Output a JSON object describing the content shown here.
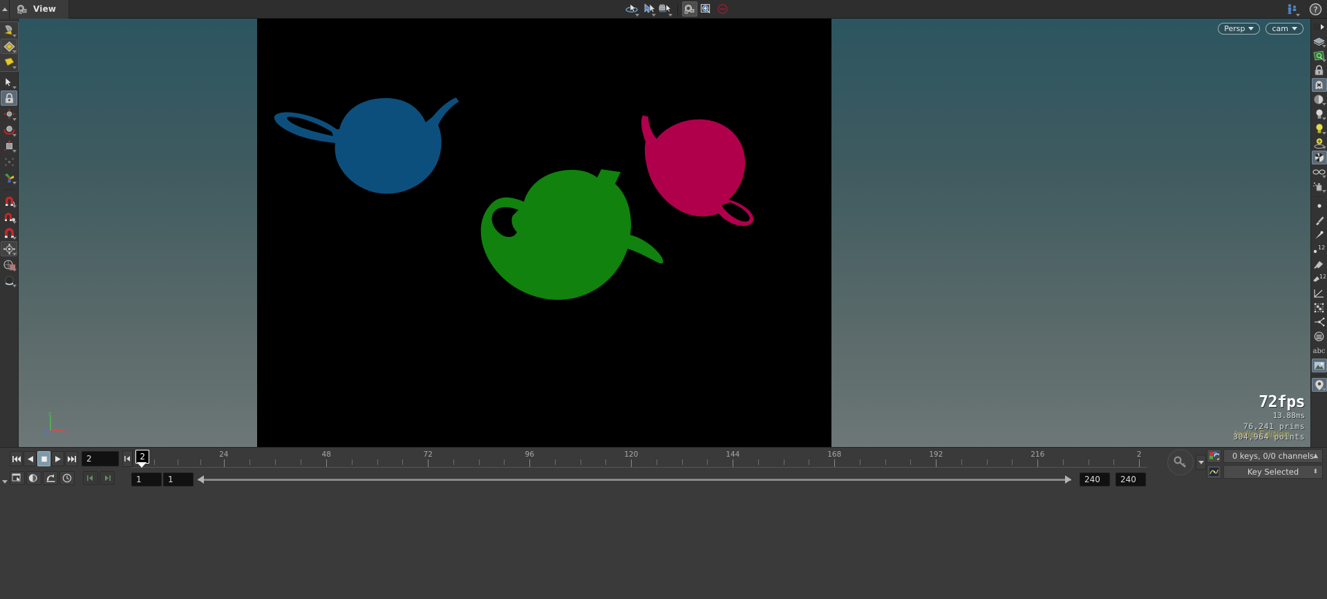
{
  "window": {
    "tab_label": "View",
    "tab_icon": "camera-icon",
    "pin_icon": "pin-triangle-icon"
  },
  "view_toolbar": {
    "tools": [
      {
        "name": "orbit-tool",
        "icon": "orbit-cursor-icon",
        "active": false,
        "has_menu": true
      },
      {
        "name": "select-tool",
        "icon": "arrow-cursor-icon",
        "active": false,
        "has_menu": true
      },
      {
        "name": "camera-cursor-tool",
        "icon": "camera-cursor-icon",
        "active": false,
        "has_menu": true
      },
      {
        "name": "camera-view-tool",
        "icon": "camera-icon",
        "active": true,
        "has_menu": false
      },
      {
        "name": "zoom-region-tool",
        "icon": "magnifier-box-icon",
        "active": false,
        "has_menu": false
      },
      {
        "name": "disable-tool",
        "icon": "circle-minus-icon",
        "active": false,
        "has_menu": false
      }
    ],
    "right_icons": [
      {
        "name": "network-users-icon",
        "icon": "two-people-icon",
        "has_menu": true
      },
      {
        "name": "help-icon",
        "icon": "question-mark-circle-icon"
      }
    ]
  },
  "left_toolbar": {
    "items": [
      {
        "name": "handle-tool",
        "icon": "grey-yellow-shape-icon",
        "state": "framed",
        "has_menu": true
      },
      {
        "name": "diamond-tool",
        "icon": "diamond-icon",
        "state": "framed",
        "has_menu": true
      },
      {
        "name": "square-tool",
        "icon": "yellow-square-icon",
        "state": "framed",
        "has_menu": true
      },
      {
        "name": "select-arrow-tool",
        "icon": "arrow-cursor-icon",
        "state": "normal",
        "has_menu": true
      },
      {
        "name": "lock-handles-tool",
        "icon": "lock-icon",
        "state": "selected",
        "has_menu": false
      },
      {
        "name": "move-tool",
        "icon": "move-handles-icon",
        "state": "normal",
        "has_menu": true
      },
      {
        "name": "rotate-tool",
        "icon": "rotate-handles-icon",
        "state": "normal",
        "has_menu": true
      },
      {
        "name": "scale-tool",
        "icon": "scale-handles-icon",
        "state": "normal",
        "has_menu": true
      },
      {
        "name": "pivot-tool",
        "icon": "pivot-icon",
        "state": "normal",
        "has_menu": false
      },
      {
        "name": "axis-gizmo-tool",
        "icon": "rgb-axis-icon",
        "state": "normal",
        "has_menu": true
      },
      {
        "name": "snap-magnet-tool",
        "icon": "magnet-icon",
        "state": "normal",
        "has_menu": true
      },
      {
        "name": "snap-point-tool",
        "icon": "magnet-point-icon",
        "state": "normal",
        "has_menu": true
      },
      {
        "name": "snap-grid-tool",
        "icon": "magnet-grid-icon",
        "state": "normal",
        "has_menu": true
      },
      {
        "name": "object-mode-tool",
        "icon": "gear-object-icon",
        "state": "framed",
        "has_menu": true
      },
      {
        "name": "construction-plane-tool",
        "icon": "circle-square-icon",
        "state": "normal",
        "has_menu": true
      },
      {
        "name": "material-ball-tool",
        "icon": "dark-ball-icon",
        "state": "normal",
        "has_menu": true
      }
    ]
  },
  "right_toolbar": {
    "items": [
      {
        "name": "expand-panel",
        "icon": "right-arrow-icon"
      },
      {
        "name": "display-layers",
        "icon": "layers-icon",
        "has_menu": true
      },
      {
        "name": "display-options",
        "icon": "green-display-icon",
        "has_menu": true
      },
      {
        "name": "lock-view",
        "icon": "padlock-icon"
      },
      {
        "name": "ghost-display",
        "icon": "ghost-x-icon",
        "state": "framed"
      },
      {
        "name": "shaded-sphere",
        "icon": "sphere-shaded-icon",
        "has_menu": true
      },
      {
        "name": "headlight",
        "icon": "bulb-icon",
        "has_menu": true
      },
      {
        "name": "scene-light",
        "icon": "yellow-bulb-icon",
        "has_menu": true
      },
      {
        "name": "light-handle",
        "icon": "light-stand-icon",
        "has_menu": true
      },
      {
        "name": "material-preview",
        "icon": "checker-ball-icon",
        "state": "framed"
      },
      {
        "name": "xray-glasses",
        "icon": "glasses-icon",
        "has_menu": true
      },
      {
        "name": "paint-spray",
        "icon": "spray-icon",
        "has_menu": true
      },
      {
        "name": "point-display",
        "icon": "dot-icon"
      },
      {
        "name": "brush-tool",
        "icon": "brush-icon"
      },
      {
        "name": "pin-marker",
        "icon": "pin-icon"
      },
      {
        "name": "point-numbers",
        "icon": "point-number-12-icon"
      },
      {
        "name": "select-hand",
        "icon": "hand-icon"
      },
      {
        "name": "prim-numbers",
        "icon": "prim-number-12-icon"
      },
      {
        "name": "measure-angle",
        "icon": "angle-measure-icon"
      },
      {
        "name": "bounding-box",
        "icon": "bbox-checker-icon"
      },
      {
        "name": "connectivity",
        "icon": "connector-icon"
      },
      {
        "name": "stack-circle",
        "icon": "circle-stack-icon"
      },
      {
        "name": "text-display",
        "icon": "abc-text-icon",
        "label": "abc"
      },
      {
        "name": "background-image",
        "icon": "image-icon",
        "state": "framed"
      },
      {
        "name": "location-pin",
        "icon": "map-pin-icon",
        "state": "framed",
        "has_menu": true
      }
    ]
  },
  "viewport": {
    "view_mode": {
      "label": "Persp",
      "icon": "chevron-down-icon"
    },
    "camera": {
      "label": "cam",
      "icon": "chevron-down-icon"
    },
    "axis_gizmo": {
      "labels": [
        "y",
        "z",
        "x"
      ],
      "colors": [
        "#44cc44",
        "#4477ee",
        "#ee4444"
      ]
    },
    "background_gradient": [
      "#2c5560",
      "#3f5b60",
      "#5c6b6b",
      "#6d7777"
    ],
    "render_region_color": "#000000",
    "stats": {
      "fps": "72fps",
      "frame_time": "13.88ms",
      "prims": "76,241  prims",
      "points": "304,964 points",
      "watermark": "Indie Edition"
    },
    "objects": [
      {
        "name": "teapot-blue",
        "color": "#0d4f7c"
      },
      {
        "name": "teapot-green",
        "color": "#10820d"
      },
      {
        "name": "teapot-crimson",
        "color": "#b0004c"
      }
    ]
  },
  "playbar": {
    "transport": [
      {
        "name": "jump-to-start-button",
        "icon": "skip-back-icon",
        "active": false
      },
      {
        "name": "play-backward-button",
        "icon": "play-back-icon",
        "active": false
      },
      {
        "name": "stop-button",
        "icon": "stop-square-icon",
        "active": true
      },
      {
        "name": "play-forward-button",
        "icon": "play-icon",
        "active": false
      },
      {
        "name": "jump-to-end-button",
        "icon": "skip-forward-icon",
        "active": false
      }
    ],
    "current_frame": "2",
    "step_back_icon": "step-back-icon",
    "step_forward_icon": "step-forward-icon",
    "transport2": [
      {
        "name": "snapshot-button",
        "icon": "snapshot-window-icon"
      },
      {
        "name": "audio-button",
        "icon": "speaker-icon"
      },
      {
        "name": "realtime-button",
        "icon": "realtime-icon"
      },
      {
        "name": "time-button",
        "icon": "clock-icon"
      },
      {
        "name": "prev-key-button",
        "icon": "prev-key-icon",
        "dim": true
      },
      {
        "name": "next-key-button",
        "icon": "next-key-icon",
        "dim": true
      }
    ],
    "playhead_frame": "2",
    "timeline_ticks": [
      {
        "label": "24",
        "pos": 9.1
      },
      {
        "label": "48",
        "pos": 19.2
      },
      {
        "label": "72",
        "pos": 29.2
      },
      {
        "label": "96",
        "pos": 39.2
      },
      {
        "label": "120",
        "pos": 49.2
      },
      {
        "label": "144",
        "pos": 59.2
      },
      {
        "label": "168",
        "pos": 69.2
      },
      {
        "label": "192",
        "pos": 79.2
      },
      {
        "label": "216",
        "pos": 89.2
      },
      {
        "label": "2",
        "pos": 99.2
      }
    ],
    "range_start": "1",
    "range_start_global": "1",
    "range_end": "240",
    "range_end_global": "240",
    "key_button": {
      "name": "set-key-button",
      "icon": "key-icon",
      "has_menu": true
    },
    "channel_rows": [
      {
        "icon": "channel-color-icon",
        "label": "0 keys, 0/0 channels",
        "arrow": "▲"
      },
      {
        "icon": "curve-editor-icon",
        "label": "Key Selected",
        "arrow": "⬍"
      }
    ]
  }
}
